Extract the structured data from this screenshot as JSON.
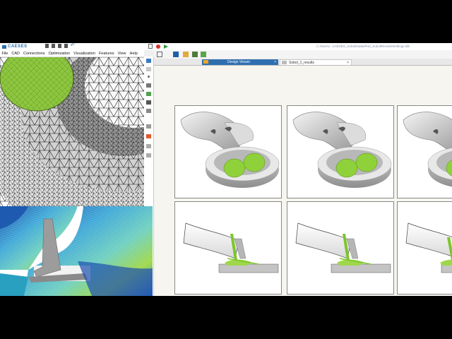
{
  "app": {
    "logo": "CAESES",
    "window_path": "C:/Users/...CAESES_Sobol/IntakePort_Sobol/Results/Settings.fdb"
  },
  "menu": [
    "File",
    "CAD",
    "Connections",
    "Optimization",
    "Visualization",
    "Features",
    "View",
    "Help"
  ],
  "tabs": {
    "design_viewer": "Design Viewer",
    "sobol_results": "Sobol_1_results",
    "close": "×"
  },
  "colors": {
    "accent": "#2f6fb0",
    "green": "#9bd23c",
    "valve_green": "#7cc62a"
  },
  "grid": {
    "rows": 2,
    "visible_columns": 3,
    "row_types": [
      "port-top-view",
      "port-section-view"
    ]
  }
}
